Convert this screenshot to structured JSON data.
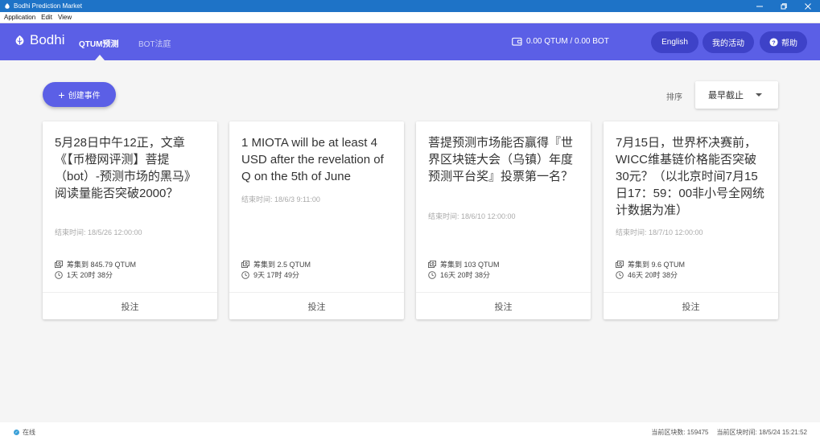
{
  "window": {
    "title": "Bodhi Prediction Market",
    "controls": [
      "minimize",
      "maximize",
      "close"
    ]
  },
  "menu": [
    "Application",
    "Edit",
    "View"
  ],
  "nav": {
    "brand": "Bodhi",
    "tabs": [
      {
        "label": "QTUM预测",
        "active": true
      },
      {
        "label": "BOT法庭",
        "active": false
      }
    ],
    "balance": "0.00 QTUM / 0.00 BOT",
    "language": "English",
    "my_activities": "我的活动",
    "help": "帮助"
  },
  "toolbar": {
    "create_label": "创建事件",
    "sort_label": "排序",
    "sort_value": "最早截止"
  },
  "cards": [
    {
      "title": "5月28日中午12正，文章《【币橙网评测】菩提（bot）-预测市场的黑马》阅读量能否突破2000？",
      "end_time": "结束时间: 18/5/26 12:00:00",
      "raised": "筹集到 845.79 QTUM",
      "time_left": "1天 20时 38分",
      "action": "投注"
    },
    {
      "title": "1 MIOTA will be at least 4 USD after the revelation of Q on the 5th of June",
      "end_time": "结束时间: 18/6/3 9:11:00",
      "raised": "筹集到 2.5 QTUM",
      "time_left": "9天 17时 49分",
      "action": "投注"
    },
    {
      "title": "菩提预测市场能否赢得『世界区块链大会（乌镇）年度预测平台奖』投票第一名？",
      "end_time": "结束时间: 18/6/10 12:00:00",
      "raised": "筹集到 103 QTUM",
      "time_left": "16天 20时 38分",
      "action": "投注"
    },
    {
      "title": "7月15日，世界杯决赛前，WICC维基链价格能否突破30元？（以北京时间7月15日17：59：00非小号全网统计数据为准）",
      "end_time": "结束时间: 18/7/10 12:00:00",
      "raised": "筹集到 9.6 QTUM",
      "time_left": "46天 20时 38分",
      "action": "投注"
    }
  ],
  "status": {
    "online": "在线",
    "block_count": "当前区块数: 159475",
    "block_time": "当前区块时间: 18/5/24 15:21:52"
  },
  "colors": {
    "titlebar": "#1e73c7",
    "nav": "#5b5fe6",
    "nav_pill": "#3e42c8",
    "background": "#f5f5f5"
  }
}
